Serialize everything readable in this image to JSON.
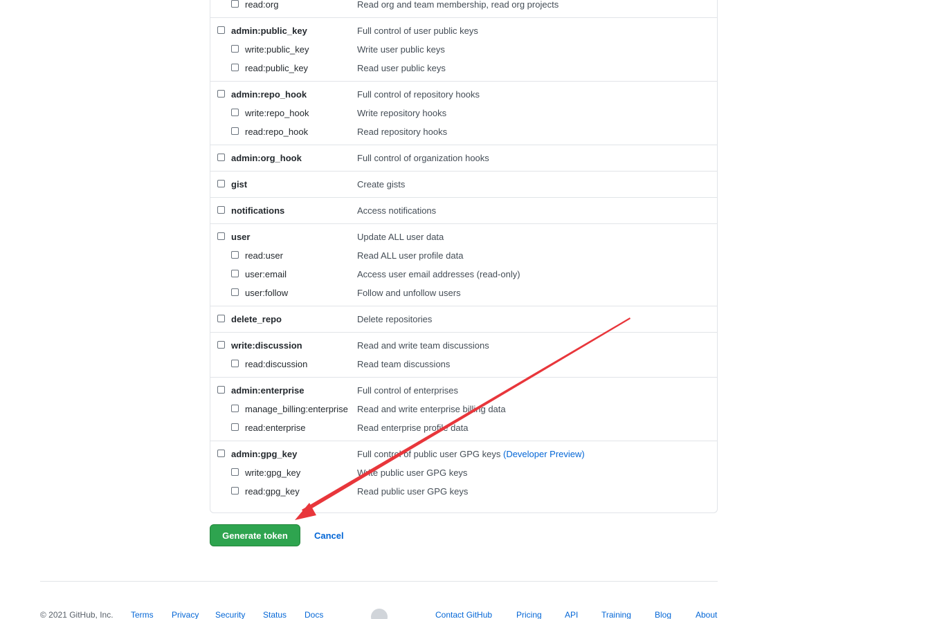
{
  "scope_groups": [
    {
      "rows": [
        {
          "name": "read:org",
          "desc": "Read org and team membership, read org projects",
          "level": "child"
        }
      ]
    },
    {
      "rows": [
        {
          "name": "admin:public_key",
          "desc": "Full control of user public keys",
          "level": "parent"
        },
        {
          "name": "write:public_key",
          "desc": "Write user public keys",
          "level": "child"
        },
        {
          "name": "read:public_key",
          "desc": "Read user public keys",
          "level": "child"
        }
      ]
    },
    {
      "rows": [
        {
          "name": "admin:repo_hook",
          "desc": "Full control of repository hooks",
          "level": "parent"
        },
        {
          "name": "write:repo_hook",
          "desc": "Write repository hooks",
          "level": "child"
        },
        {
          "name": "read:repo_hook",
          "desc": "Read repository hooks",
          "level": "child"
        }
      ]
    },
    {
      "rows": [
        {
          "name": "admin:org_hook",
          "desc": "Full control of organization hooks",
          "level": "parent"
        }
      ]
    },
    {
      "rows": [
        {
          "name": "gist",
          "desc": "Create gists",
          "level": "parent"
        }
      ]
    },
    {
      "rows": [
        {
          "name": "notifications",
          "desc": "Access notifications",
          "level": "parent"
        }
      ]
    },
    {
      "rows": [
        {
          "name": "user",
          "desc": "Update ALL user data",
          "level": "parent"
        },
        {
          "name": "read:user",
          "desc": "Read ALL user profile data",
          "level": "child"
        },
        {
          "name": "user:email",
          "desc": "Access user email addresses (read-only)",
          "level": "child"
        },
        {
          "name": "user:follow",
          "desc": "Follow and unfollow users",
          "level": "child"
        }
      ]
    },
    {
      "rows": [
        {
          "name": "delete_repo",
          "desc": "Delete repositories",
          "level": "parent"
        }
      ]
    },
    {
      "rows": [
        {
          "name": "write:discussion",
          "desc": "Read and write team discussions",
          "level": "parent"
        },
        {
          "name": "read:discussion",
          "desc": "Read team discussions",
          "level": "child"
        }
      ]
    },
    {
      "rows": [
        {
          "name": "admin:enterprise",
          "desc": "Full control of enterprises",
          "level": "parent"
        },
        {
          "name": "manage_billing:enterprise",
          "desc": "Read and write enterprise billing data",
          "level": "child"
        },
        {
          "name": "read:enterprise",
          "desc": "Read enterprise profile data",
          "level": "child"
        }
      ]
    },
    {
      "rows": [
        {
          "name": "admin:gpg_key",
          "desc": "Full control of public user GPG keys",
          "desc_link": "(Developer Preview)",
          "level": "parent"
        },
        {
          "name": "write:gpg_key",
          "desc": "Write public user GPG keys",
          "level": "child"
        },
        {
          "name": "read:gpg_key",
          "desc": "Read public user GPG keys",
          "level": "child"
        }
      ]
    }
  ],
  "actions": {
    "generate_label": "Generate token",
    "cancel_label": "Cancel"
  },
  "footer": {
    "copyright": "© 2021 GitHub, Inc.",
    "left_links": [
      "Terms",
      "Privacy",
      "Security",
      "Status",
      "Docs"
    ],
    "right_links": [
      "Contact GitHub",
      "Pricing",
      "API",
      "Training",
      "Blog",
      "About"
    ],
    "logo_icon": "github-mark-icon"
  },
  "colors": {
    "primary_button": "#2ea44f",
    "link": "#0366d6",
    "annotation_arrow": "#e8363b"
  }
}
